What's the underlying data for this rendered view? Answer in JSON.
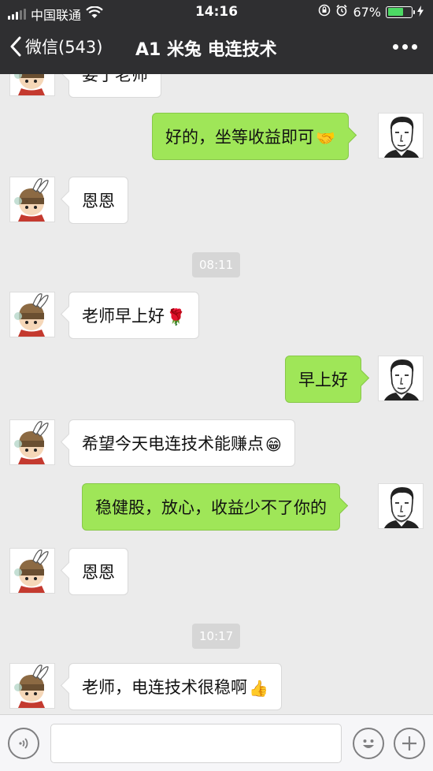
{
  "status_bar": {
    "carrier": "中国联通",
    "time": "14:16",
    "battery_percent": "67%",
    "battery_level": 0.67,
    "icons": [
      "signal-icon",
      "wifi-icon",
      "rotation-lock-icon",
      "alarm-icon",
      "battery-icon",
      "charging-icon"
    ]
  },
  "nav": {
    "back_label": "微信(543)",
    "title": "A1 米兔 电连技术",
    "more_icon": "more-icon"
  },
  "messages": [
    {
      "side": "recv",
      "text": "要了老师",
      "emoji": ""
    },
    {
      "side": "sent",
      "text": "好的，坐等收益即可",
      "emoji": "🤝"
    },
    {
      "side": "recv",
      "text": "恩恩",
      "emoji": ""
    },
    {
      "side": "time",
      "text": "08:11"
    },
    {
      "side": "recv",
      "text": "老师早上好",
      "emoji": "🌹"
    },
    {
      "side": "sent",
      "text": "早上好",
      "emoji": ""
    },
    {
      "side": "recv",
      "text": "希望今天电连技术能赚点",
      "emoji": "😁"
    },
    {
      "side": "sent",
      "text": "稳健股，放心，收益少不了你的",
      "emoji": ""
    },
    {
      "side": "recv",
      "text": "恩恩",
      "emoji": ""
    },
    {
      "side": "time",
      "text": "10:17"
    },
    {
      "side": "recv",
      "text": "老师，电连技术很稳啊",
      "emoji": "👍"
    }
  ],
  "input_bar": {
    "voice_icon": "voice-icon",
    "emoji_icon": "emoji-icon",
    "plus_icon": "plus-icon",
    "input_value": ""
  },
  "colors": {
    "bar_bg": "#2f2f31",
    "chat_bg": "#ebebeb",
    "sent_bubble": "#9fe658",
    "recv_bubble": "#ffffff",
    "time_badge": "#d6d6d6"
  }
}
